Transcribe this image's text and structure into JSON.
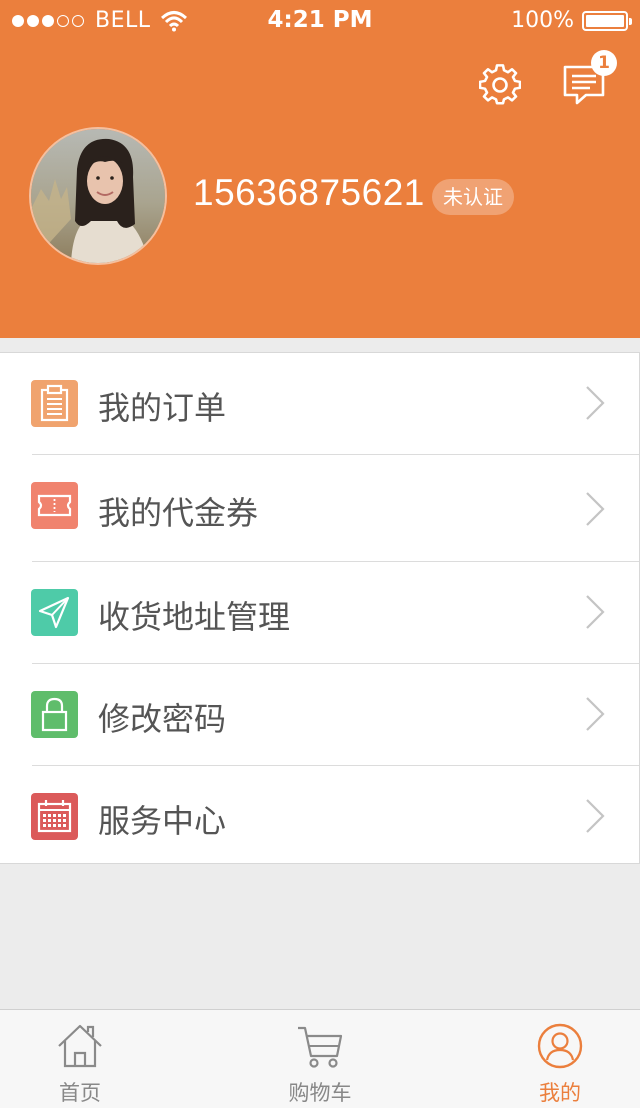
{
  "status_bar": {
    "carrier": "BELL",
    "time": "4:21 PM",
    "battery": "100%"
  },
  "header": {
    "unread_count": "1",
    "phone": "15636875621",
    "verify_status": "未认证"
  },
  "menu": {
    "items": [
      {
        "label": "我的订单",
        "icon": "clipboard-icon",
        "color": "#f0a36e"
      },
      {
        "label": "我的代金券",
        "icon": "ticket-icon",
        "color": "#f0836e"
      },
      {
        "label": "收货地址管理",
        "icon": "paper-plane-icon",
        "color": "#4ecba8"
      },
      {
        "label": "修改密码",
        "icon": "lock-icon",
        "color": "#5fbd6b"
      },
      {
        "label": "服务中心",
        "icon": "calendar-icon",
        "color": "#db5a5a"
      }
    ]
  },
  "tabbar": {
    "tabs": [
      {
        "label": "首页",
        "icon": "home-icon"
      },
      {
        "label": "购物车",
        "icon": "cart-icon"
      },
      {
        "label": "我的",
        "icon": "user-icon",
        "active": true
      }
    ]
  },
  "colors": {
    "accent": "#eb7f3d",
    "background": "#ececec"
  }
}
